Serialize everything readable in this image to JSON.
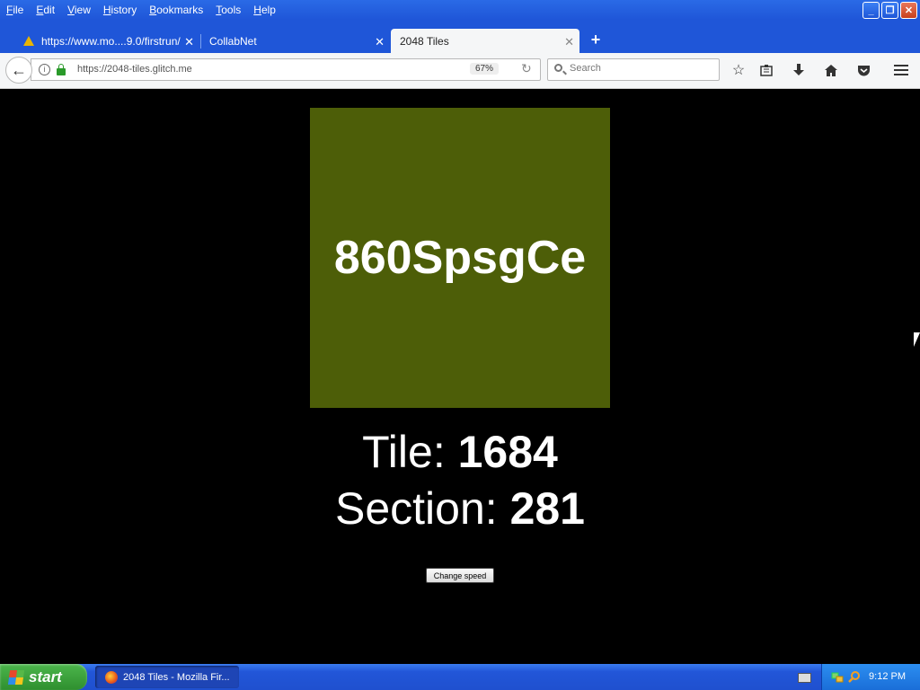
{
  "menu": [
    "File",
    "Edit",
    "View",
    "History",
    "Bookmarks",
    "Tools",
    "Help"
  ],
  "tabs": [
    {
      "label": "https://www.mo....9.0/firstrun/",
      "icon": "warning-icon",
      "active": false
    },
    {
      "label": "CollabNet",
      "active": false
    },
    {
      "label": "2048 Tiles",
      "active": true
    }
  ],
  "navbar": {
    "url": "https://2048-tiles.glitch.me",
    "zoom": "67%",
    "search_placeholder": "Search"
  },
  "page": {
    "tile_text": "860SpsgCe",
    "tile_color": "#4d5e08",
    "tile_label": "Tile: ",
    "tile_value": "1684",
    "section_label": "Section: ",
    "section_value": "281",
    "button_label": "Change speed"
  },
  "taskbar": {
    "start_label": "start",
    "task_item": "2048 Tiles - Mozilla Fir...",
    "clock": "9:12 PM"
  }
}
